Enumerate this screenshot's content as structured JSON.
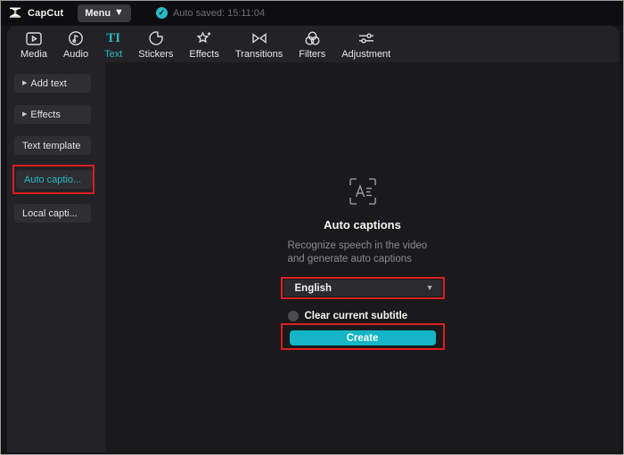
{
  "topbar": {
    "app_name": "CapCut",
    "menu_label": "Menu",
    "autosave_text": "Auto saved: 15:11:04"
  },
  "toolbar": {
    "tabs": [
      {
        "label": "Media",
        "icon": "media-icon",
        "active": false
      },
      {
        "label": "Audio",
        "icon": "audio-icon",
        "active": false
      },
      {
        "label": "Text",
        "icon": "text-icon",
        "active": true
      },
      {
        "label": "Stickers",
        "icon": "stickers-icon",
        "active": false
      },
      {
        "label": "Effects",
        "icon": "effects-icon",
        "active": false
      },
      {
        "label": "Transitions",
        "icon": "transitions-icon",
        "active": false
      },
      {
        "label": "Filters",
        "icon": "filters-icon",
        "active": false
      },
      {
        "label": "Adjustment",
        "icon": "adjustment-icon",
        "active": false
      }
    ],
    "text_tab_glyph": "TI"
  },
  "sidebar": {
    "items": [
      {
        "label": "Add text",
        "expandable": true,
        "active": false
      },
      {
        "label": "Effects",
        "expandable": true,
        "active": false
      },
      {
        "label": "Text template",
        "expandable": false,
        "active": false
      },
      {
        "label": "Auto captio...",
        "expandable": false,
        "active": true,
        "highlighted": true
      },
      {
        "label": "Local capti...",
        "expandable": false,
        "active": false
      }
    ]
  },
  "panel": {
    "icon": "auto-captions-frame-icon",
    "title": "Auto captions",
    "description_line1": "Recognize speech in the video",
    "description_line2": "and generate auto captions",
    "language_selected": "English",
    "clear_subtitle_label": "Clear current subtitle",
    "clear_subtitle_checked": false,
    "create_label": "Create"
  },
  "icons": {
    "logo": "capcut-logo",
    "menu_chevron": "chevron-down-icon",
    "autosave_check": "check-circle-icon",
    "dropdown_chevron": "chevron-down-icon",
    "checkbox": "circle-unchecked-icon",
    "expand_arrow": "triangle-right-icon"
  },
  "colors": {
    "accent": "#2bb8c5",
    "highlight_red": "#dc1f1f",
    "create_button": "#14b5c6"
  }
}
